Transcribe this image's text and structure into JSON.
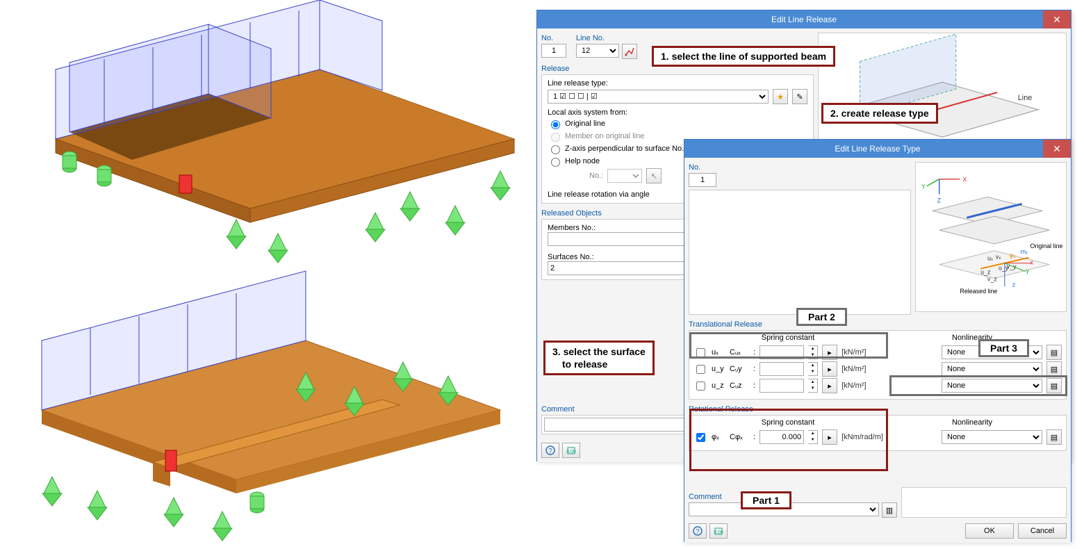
{
  "dialog1": {
    "title": "Edit Line Release",
    "no_label": "No.",
    "no_value": "1",
    "lineno_label": "Line No.",
    "lineno_value": "12",
    "release_header": "Release",
    "release_type_label": "Line release type:",
    "release_type_value": "1  ☑ ☐ ☐ | ☑",
    "local_axis_label": "Local axis system from:",
    "radio_original": "Original line",
    "radio_member": "Member on original line",
    "radio_zaxis": "Z-axis perpendicular to surface No.:",
    "radio_help": "Help node",
    "surf_no_label": "No.:",
    "rotation_label": "Line release rotation via angle",
    "released_header": "Released Objects",
    "members_label": "Members No.:",
    "members_value": "",
    "surfaces_label": "Surfaces No.:",
    "surfaces_value": "2",
    "comment_label": "Comment",
    "illus_line_label": "Line"
  },
  "dialog2": {
    "title": "Edit Line Release Type",
    "no_label": "No.",
    "no_value": "1",
    "trans_header": "Translational Release",
    "rot_header": "Rotational Release",
    "spring_label": "Spring constant",
    "nonlin_label": "Nonlinearity",
    "rows": {
      "ux": {
        "sym": "uₓ",
        "c": "Cᵤₓ",
        "unit": "[kN/m²]",
        "val": "",
        "nl": "None"
      },
      "uy": {
        "sym": "u_y",
        "c": "Cᵤy",
        "unit": "[kN/m²]",
        "val": "",
        "nl": "None"
      },
      "uz": {
        "sym": "u_z",
        "c": "Cᵤz",
        "unit": "[kN/m²]",
        "val": "",
        "nl": "None"
      },
      "phix": {
        "sym": "φₓ",
        "c": "Cφₓ",
        "unit": "[kNm/rad/m]",
        "val": "0.000",
        "nl": "None"
      }
    },
    "comment_label": "Comment",
    "ok": "OK",
    "cancel": "Cancel",
    "illus_original": "Original line",
    "illus_released": "Released line",
    "illus_mx": "mₓ",
    "illus_phix": "φₓ",
    "illus_ux": "uₓ",
    "illus_vx": "vₓ",
    "illus_uy": "u_y",
    "illus_vy": "v_y",
    "illus_uz": "u_z",
    "illus_vz": "v_z",
    "axis_x": "x",
    "axis_y": "y",
    "axis_z": "z",
    "axis_X": "X",
    "axis_Y": "Y",
    "axis_Z": "Z"
  },
  "callouts": {
    "c1": "1. select the line of supported beam",
    "c2": "2. create release type",
    "c3a": "3. select the surface",
    "c3b": "to release",
    "p1": "Part 1",
    "p2": "Part 2",
    "p3": "Part 3"
  }
}
